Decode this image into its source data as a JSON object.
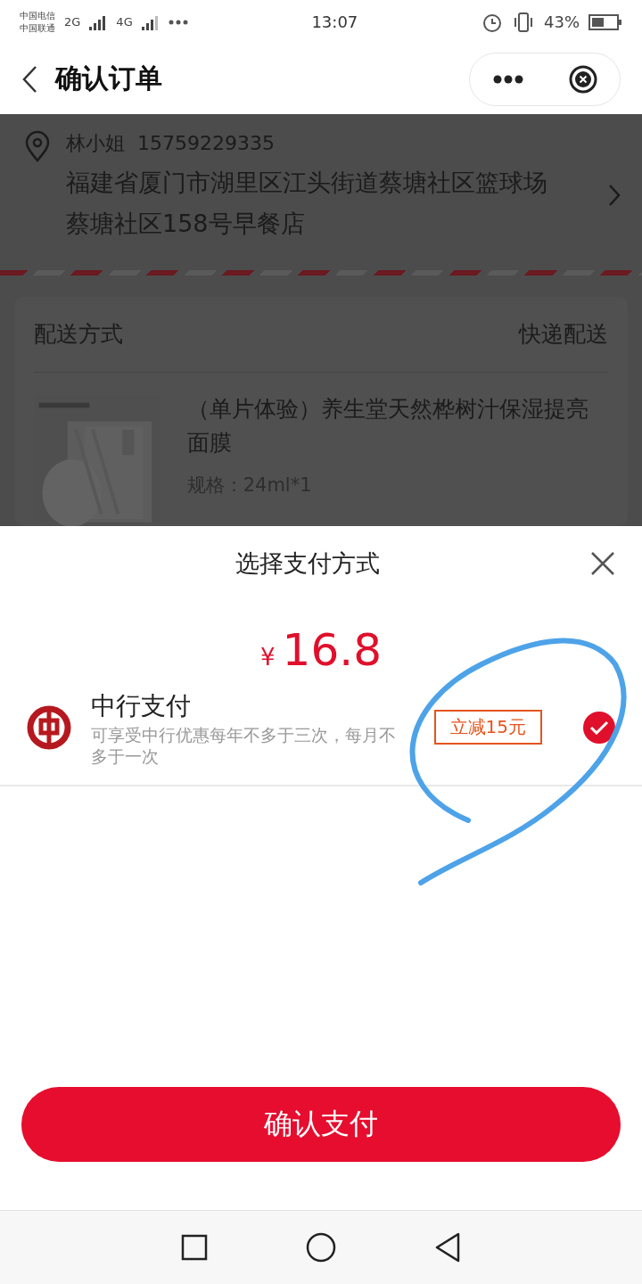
{
  "status_bar": {
    "carriers": [
      "中国电信",
      "中国联通"
    ],
    "networks": [
      "2G",
      "4G"
    ],
    "time": "13:07",
    "battery": "43%"
  },
  "nav": {
    "title": "确认订单"
  },
  "address": {
    "name": "林小姐",
    "phone": "15759229335",
    "detail": "福建省厦门市湖里区江头街道蔡塘社区篮球场蔡塘社区158号早餐店"
  },
  "delivery": {
    "label": "配送方式",
    "value": "快递配送"
  },
  "product": {
    "kind": "picture",
    "title": "（单片体验）养生堂天然桦树汁保湿提亮面膜",
    "spec": "规格：24ml*1"
  },
  "payment_sheet": {
    "title": "选择支付方式",
    "currency": "¥",
    "amount": "16.8",
    "methods": [
      {
        "name": "中行支付",
        "note": "可享受中行优惠每年不多于三次，每月不多于一次",
        "tag": "立减15元",
        "selected": true
      }
    ],
    "confirm": "确认支付"
  }
}
